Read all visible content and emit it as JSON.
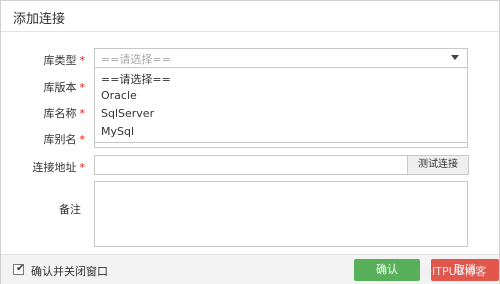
{
  "dialog": {
    "title": "添加连接"
  },
  "form": {
    "db_type": {
      "label": "库类型",
      "required_mark": "*",
      "placeholder": "==请选择=="
    },
    "db_type_options": [
      "==请选择==",
      "Oracle",
      "SqlServer",
      "MySql"
    ],
    "db_version": {
      "label": "库版本",
      "required_mark": "*"
    },
    "db_name": {
      "label": "库名称",
      "required_mark": "*"
    },
    "db_alias": {
      "label": "库别名",
      "required_mark": "*"
    },
    "address": {
      "label": "连接地址",
      "required_mark": "*",
      "value": ""
    },
    "test_button": "测试连接",
    "remark": {
      "label": "备注",
      "value": ""
    }
  },
  "footer": {
    "checkbox_label": "确认并关闭窗口",
    "checked": true,
    "ok_button": "确认",
    "cancel_button": "取消",
    "watermark": "@ITPUB博客"
  }
}
